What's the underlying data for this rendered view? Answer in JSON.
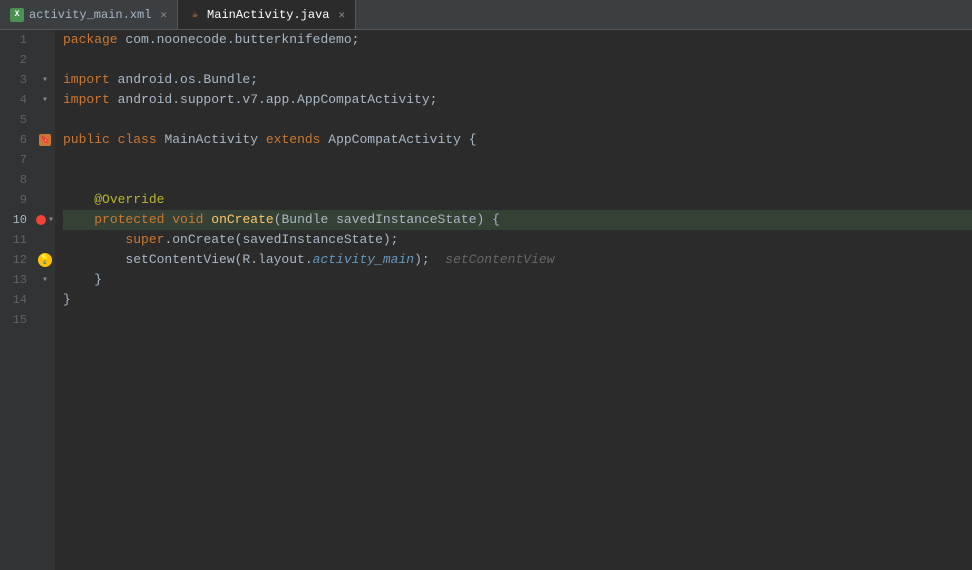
{
  "tabs": [
    {
      "id": "activity_main_xml",
      "label": "activity_main.xml",
      "icon": "xml-icon",
      "active": false,
      "closeable": true
    },
    {
      "id": "mainactivity_java",
      "label": "MainActivity.java",
      "icon": "java-icon",
      "active": true,
      "closeable": true
    }
  ],
  "colors": {
    "background": "#2b2b2b",
    "gutter_bg": "#313335",
    "active_line": "#344134",
    "keyword": "#cc7832",
    "annotation": "#bbb529",
    "method": "#ffc66d",
    "number": "#6897bb",
    "string_italic": "#6897bb",
    "normal": "#a9b7c6"
  },
  "lines": [
    {
      "num": 1,
      "content": "package com.noonecode.butterknifedemo;",
      "tokens": [
        {
          "t": "kw-package",
          "v": "package"
        },
        {
          "t": "normal",
          "v": " com.noonecode.butterknifedemo;"
        }
      ]
    },
    {
      "num": 2,
      "content": "",
      "tokens": []
    },
    {
      "num": 3,
      "content": "import android.os.Bundle;",
      "tokens": [
        {
          "t": "kw-import",
          "v": "import"
        },
        {
          "t": "normal",
          "v": " android.os.Bundle;"
        }
      ],
      "fold": "left"
    },
    {
      "num": 4,
      "content": "import android.support.v7.app.AppCompatActivity;",
      "tokens": [
        {
          "t": "kw-import",
          "v": "import"
        },
        {
          "t": "normal",
          "v": " android.support.v7.app.AppCompatActivity;"
        }
      ],
      "fold": "left"
    },
    {
      "num": 5,
      "content": "",
      "tokens": []
    },
    {
      "num": 6,
      "content": "public class MainActivity extends AppCompatActivity {",
      "tokens": [
        {
          "t": "kw-public",
          "v": "public"
        },
        {
          "t": "normal",
          "v": " "
        },
        {
          "t": "kw-class",
          "v": "class"
        },
        {
          "t": "normal",
          "v": " MainActivity "
        },
        {
          "t": "kw-extends",
          "v": "extends"
        },
        {
          "t": "normal",
          "v": " AppCompatActivity {"
        }
      ],
      "bookmark": true
    },
    {
      "num": 7,
      "content": "",
      "tokens": []
    },
    {
      "num": 8,
      "content": "",
      "tokens": []
    },
    {
      "num": 9,
      "content": "    @Override",
      "tokens": [
        {
          "t": "normal",
          "v": "    "
        },
        {
          "t": "annotation",
          "v": "@Override"
        }
      ]
    },
    {
      "num": 10,
      "content": "    protected void onCreate(Bundle savedInstanceState) {",
      "tokens": [
        {
          "t": "normal",
          "v": "    "
        },
        {
          "t": "kw-protected",
          "v": "protected"
        },
        {
          "t": "normal",
          "v": " "
        },
        {
          "t": "kw-void",
          "v": "void"
        },
        {
          "t": "normal",
          "v": " "
        },
        {
          "t": "method-name",
          "v": "onCreate"
        },
        {
          "t": "normal",
          "v": "(Bundle savedInstanceState) {"
        }
      ],
      "debug": true,
      "fold": "left"
    },
    {
      "num": 11,
      "content": "        super.onCreate(savedInstanceState);",
      "tokens": [
        {
          "t": "normal",
          "v": "        "
        },
        {
          "t": "kw-super",
          "v": "super"
        },
        {
          "t": "normal",
          "v": ".onCreate(savedInstanceState);"
        }
      ]
    },
    {
      "num": 12,
      "content": "        setContentView(R.layout.activity_main);",
      "tokens": [
        {
          "t": "normal",
          "v": "        setContentView(R.layout."
        },
        {
          "t": "string-italic",
          "v": "activity_main"
        },
        {
          "t": "normal",
          "v": ");"
        }
      ],
      "bulb": true,
      "ghost": "setContentView"
    },
    {
      "num": 13,
      "content": "    }",
      "tokens": [
        {
          "t": "normal",
          "v": "    }"
        }
      ],
      "fold": "left"
    },
    {
      "num": 14,
      "content": "}",
      "tokens": [
        {
          "t": "normal",
          "v": "}"
        }
      ]
    },
    {
      "num": 15,
      "content": "",
      "tokens": []
    }
  ]
}
